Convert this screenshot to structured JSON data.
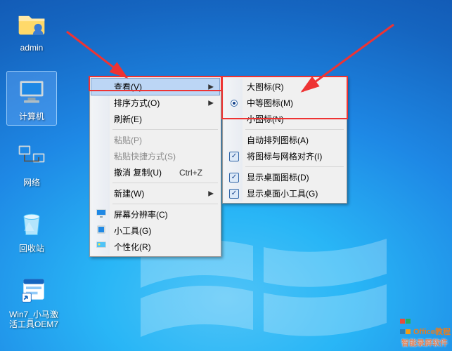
{
  "desktop_icons": {
    "admin": "admin",
    "computer": "计算机",
    "network": "网络",
    "recycle": "回收站",
    "shortcut": "Win7_小马激活工具OEM7"
  },
  "menu1": {
    "view": "查看(V)",
    "sort": "排序方式(O)",
    "refresh": "刷新(E)",
    "paste": "粘贴(P)",
    "paste_shortcut": "粘贴快捷方式(S)",
    "undo_copy": "撤消 复制(U)",
    "undo_copy_shortcut": "Ctrl+Z",
    "new": "新建(W)",
    "resolution": "屏幕分辨率(C)",
    "gadgets": "小工具(G)",
    "personalize": "个性化(R)"
  },
  "menu2": {
    "large": "大图标(R)",
    "medium": "中等图标(M)",
    "small": "小图标(N)",
    "auto_arrange": "自动排列图标(A)",
    "align_grid": "将图标与网格对齐(I)",
    "show_icons": "显示桌面图标(D)",
    "show_gadgets": "显示桌面小工具(G)"
  },
  "watermark": "智能录屏软件",
  "logo_text": "Office教程"
}
